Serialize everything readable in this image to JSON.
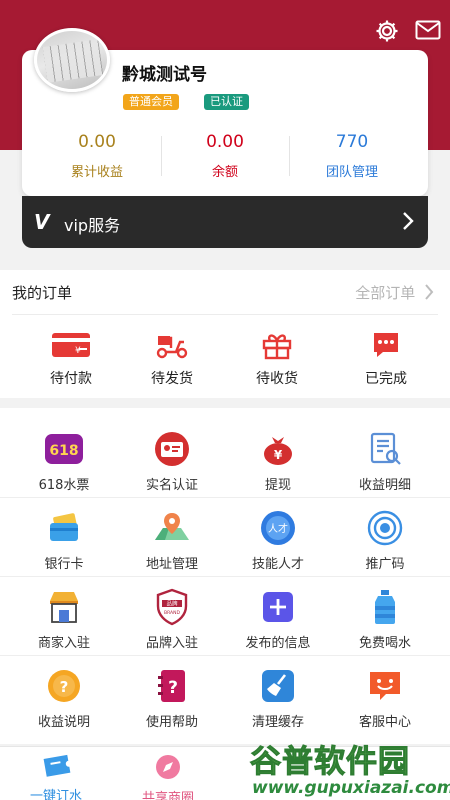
{
  "profile": {
    "username": "黔城测试号",
    "badge_member": "普通会员",
    "badge_certified": "已认证"
  },
  "stats": [
    {
      "value": "0.00",
      "label": "累计收益"
    },
    {
      "value": "0.00",
      "label": "余额"
    },
    {
      "value": "770",
      "label": "团队管理"
    }
  ],
  "vip": {
    "logo": "V",
    "label": "vip服务"
  },
  "orders": {
    "title": "我的订单",
    "all_label": "全部订单",
    "items": [
      {
        "label": "待付款",
        "icon": "card-icon"
      },
      {
        "label": "待发货",
        "icon": "scooter-icon"
      },
      {
        "label": "待收货",
        "icon": "gift-icon"
      },
      {
        "label": "已完成",
        "icon": "chat-icon"
      }
    ]
  },
  "services": [
    {
      "label": "618水票",
      "icon": "618-ticket-icon"
    },
    {
      "label": "实名认证",
      "icon": "id-card-icon"
    },
    {
      "label": "提现",
      "icon": "money-bag-icon"
    },
    {
      "label": "收益明细",
      "icon": "report-icon"
    },
    {
      "label": "银行卡",
      "icon": "bank-card-icon"
    },
    {
      "label": "地址管理",
      "icon": "map-pin-icon"
    },
    {
      "label": "技能人才",
      "icon": "talent-icon"
    },
    {
      "label": "推广码",
      "icon": "target-icon"
    },
    {
      "label": "商家入驻",
      "icon": "shop-icon"
    },
    {
      "label": "品牌入驻",
      "icon": "brand-shield-icon"
    },
    {
      "label": "发布的信息",
      "icon": "plus-icon"
    },
    {
      "label": "免费喝水",
      "icon": "water-bottle-icon"
    },
    {
      "label": "收益说明",
      "icon": "question-icon"
    },
    {
      "label": "使用帮助",
      "icon": "help-book-icon"
    },
    {
      "label": "清理缓存",
      "icon": "broom-icon"
    },
    {
      "label": "客服中心",
      "icon": "service-smile-icon"
    }
  ],
  "tabs": [
    {
      "label": "一键订水",
      "icon": "ticket-icon"
    },
    {
      "label": "共享商圈",
      "icon": "compass-icon"
    }
  ],
  "watermark": {
    "title": "谷普软件园",
    "url": "www.gupuxiazai.com"
  },
  "colors": {
    "header": "#a61a33",
    "accent_red": "#d0021b",
    "gold": "#a9821e",
    "blue": "#2b7ad8",
    "vip_bg": "#2a2a2a"
  }
}
